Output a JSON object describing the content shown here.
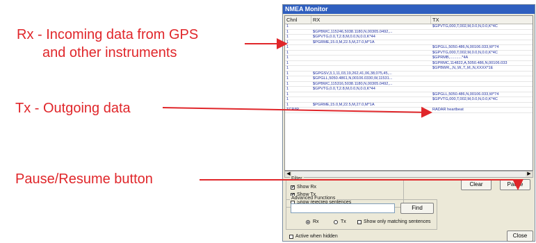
{
  "callouts": {
    "rx_line1": "Rx - Incoming data from GPS",
    "rx_line2": "and other instruments",
    "tx": "Tx - Outgoing data",
    "pause": "Pause/Resume button"
  },
  "window": {
    "title": "NMEA Monitor",
    "columns": [
      "Chnl",
      "RX",
      "TX"
    ]
  },
  "rows": [
    {
      "ch": "1",
      "rx": "",
      "tx": "$GPVTG,000,T,002,M,0.0,N,0.0,K*4C"
    },
    {
      "ch": "1",
      "rx": "$GPBWC,115246,5038.1180,N,00305.0492,...",
      "tx": ""
    },
    {
      "ch": "1",
      "rx": "$GPVTG,0.0,T,2.8,M,0.0,N,0.0,K*44",
      "tx": ""
    },
    {
      "ch": "1",
      "rx": "$PGRME,15.0,M,22.5,M,27.0,M*1A",
      "tx": ""
    },
    {
      "ch": "1",
      "rx": "",
      "tx": "$GPGLL,5050.486,N,00106.033,W*74"
    },
    {
      "ch": "1",
      "rx": "",
      "tx": "$GPVTG,000,T,002,M,0.0,N,0.0,K*4C"
    },
    {
      "ch": "1",
      "rx": "",
      "tx": "$GPRMB,...........*4A"
    },
    {
      "ch": "1",
      "rx": "",
      "tx": "$GPRMC,114822,A,5050.486,N,00106.033"
    },
    {
      "ch": "1",
      "rx": "",
      "tx": "$GPBWR,,,N,,W,,T,,M,,N,XXXX*1E"
    },
    {
      "ch": "1",
      "rx": "$GPGSV,3,1,11,03,19,262,41,06,38,075,45,...",
      "tx": ""
    },
    {
      "ch": "1",
      "rx": "$GPGLL,5050.4861,N,00106.0330,W,11531...",
      "tx": ""
    },
    {
      "ch": "1",
      "rx": "$GPBWC,115316,5038.1180,N,00305.0492,...",
      "tx": ""
    },
    {
      "ch": "1",
      "rx": "$GPVTG,0.0,T,2.8,M,0.0,N,0.0,K*44",
      "tx": ""
    },
    {
      "ch": "1",
      "rx": "",
      "tx": "$GPGLL,5050.486,N,00106.033,W*74"
    },
    {
      "ch": "1",
      "rx": "",
      "tx": "$GPVTG,000,T,002,M,0.0,N,0.0,K*4C"
    },
    {
      "ch": "1",
      "rx": "$PGRME,15.0,M,22.5,M,27.0,M*1A",
      "tx": ""
    },
    {
      "ch": "TCP/IP",
      "rx": "",
      "tx": "RADAR heartbeat"
    }
  ],
  "filter": {
    "label": "Filter",
    "show_rx": {
      "label": "Show Rx",
      "checked": true
    },
    "show_tx": {
      "label": "Show Tx",
      "checked": true
    },
    "show_rejected": {
      "label": "Show rejected sentences",
      "checked": false
    }
  },
  "buttons": {
    "clear": "Clear",
    "pause": "Pause",
    "find": "Find",
    "close": "Close"
  },
  "advanced": {
    "label": "Advanced Functions",
    "search_value": "",
    "radio_rx": "Rx",
    "radio_tx": "Tx",
    "selected": "Rx",
    "only_matching": "Show only matching sentences",
    "active_hidden": "Active when hidden"
  },
  "colors": {
    "callout_red": "#e0262a",
    "titlebar_blue": "#2f5fbf",
    "row_text_blue": "#2030a0"
  },
  "icons": {
    "scroll_left": "◀",
    "scroll_right": "▶",
    "check": "✔"
  }
}
